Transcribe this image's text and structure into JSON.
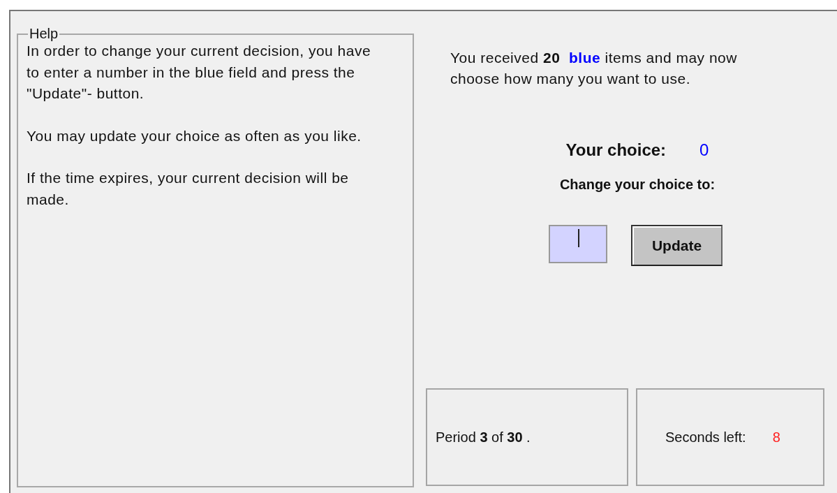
{
  "help": {
    "title": "Help",
    "paragraphs": [
      "In order to change your current decision, you have to enter a number in the blue field and press the \"Update\"- button.",
      "You may update your choice as often as you like.",
      "If the time expires, your current decision will be made."
    ]
  },
  "intro": {
    "before": "You received",
    "count": "20",
    "highlight": "blue",
    "color": "#0000ff",
    "after": "items and may now choose how many you want to use."
  },
  "choice": {
    "label": "Your choice:",
    "value": "0"
  },
  "change": {
    "label": "Change your choice to:",
    "button": "Update"
  },
  "period": "Period **3** of **30** .",
  "timer": {
    "label": "Seconds left:",
    "value": "8"
  }
}
